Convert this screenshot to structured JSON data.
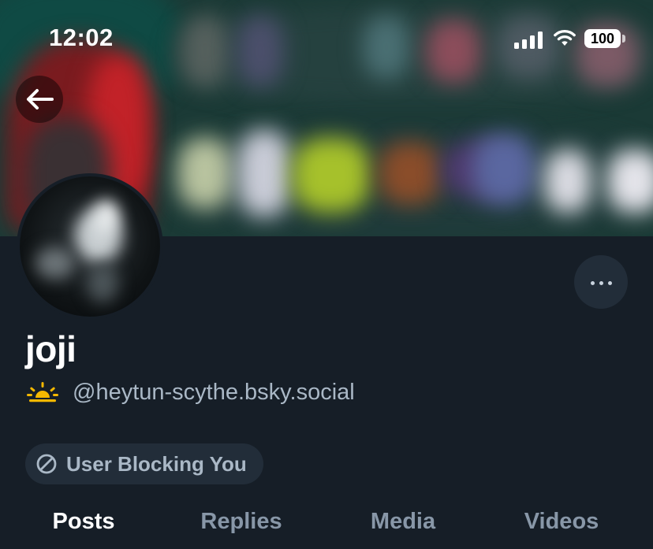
{
  "status_bar": {
    "time": "12:02",
    "battery": "100",
    "icons": [
      "signal-icon",
      "wifi-icon",
      "battery-icon"
    ]
  },
  "header": {
    "back_icon": "arrow-left-icon",
    "more_icon": "ellipsis-icon"
  },
  "profile": {
    "display_name": "joji",
    "handle": "@heytun-scythe.bsky.social",
    "handle_icon": "sunrise-icon",
    "blocked_label": "User Blocking You",
    "blocked_icon": "block-icon"
  },
  "tabs": [
    {
      "label": "Posts",
      "active": true
    },
    {
      "label": "Replies",
      "active": false
    },
    {
      "label": "Media",
      "active": false
    },
    {
      "label": "Videos",
      "active": false
    }
  ],
  "colors": {
    "background": "#161e27",
    "muted_text": "#aab8c6",
    "badge_bg": "#222d39",
    "sun": "#f5b800"
  }
}
